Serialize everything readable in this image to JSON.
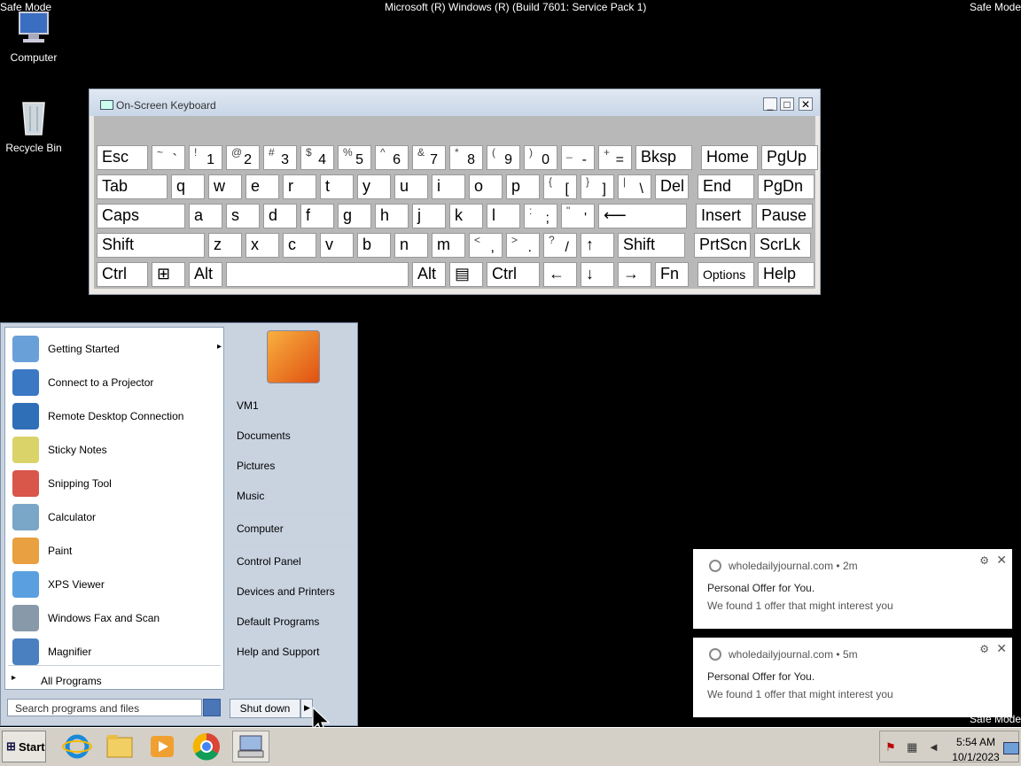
{
  "banner": {
    "left": "Safe Mode",
    "center": "Microsoft (R) Windows (R) (Build 7601: Service Pack 1)",
    "right": "Safe Mode",
    "bottom_right": "Safe Mode"
  },
  "desktop": {
    "computer": "Computer",
    "recycle": "Recycle Bin"
  },
  "osk": {
    "title": "On-Screen Keyboard",
    "rows": [
      [
        {
          "main": "Esc"
        },
        {
          "top": "~",
          "bot": "`"
        },
        {
          "top": "!",
          "bot": "1"
        },
        {
          "top": "@",
          "bot": "2"
        },
        {
          "top": "#",
          "bot": "3"
        },
        {
          "top": "$",
          "bot": "4"
        },
        {
          "top": "%",
          "bot": "5"
        },
        {
          "top": "^",
          "bot": "6"
        },
        {
          "top": "&",
          "bot": "7"
        },
        {
          "top": "*",
          "bot": "8"
        },
        {
          "top": "(",
          "bot": "9"
        },
        {
          "top": ")",
          "bot": "0"
        },
        {
          "top": "_",
          "bot": "-"
        },
        {
          "top": "+",
          "bot": "="
        },
        {
          "main": "Bksp"
        },
        {
          "main": "Home"
        },
        {
          "main": "PgUp"
        }
      ],
      [
        {
          "main": "Tab"
        },
        {
          "main": "q"
        },
        {
          "main": "w"
        },
        {
          "main": "e"
        },
        {
          "main": "r"
        },
        {
          "main": "t"
        },
        {
          "main": "y"
        },
        {
          "main": "u"
        },
        {
          "main": "i"
        },
        {
          "main": "o"
        },
        {
          "main": "p"
        },
        {
          "top": "{",
          "bot": "["
        },
        {
          "top": "}",
          "bot": "]"
        },
        {
          "top": "|",
          "bot": "\\"
        },
        {
          "main": "Del"
        },
        {
          "main": "End"
        },
        {
          "main": "PgDn"
        }
      ],
      [
        {
          "main": "Caps"
        },
        {
          "main": "a"
        },
        {
          "main": "s"
        },
        {
          "main": "d"
        },
        {
          "main": "f"
        },
        {
          "main": "g"
        },
        {
          "main": "h"
        },
        {
          "main": "j"
        },
        {
          "main": "k"
        },
        {
          "main": "l"
        },
        {
          "top": ":",
          "bot": ";"
        },
        {
          "top": "\"",
          "bot": "'"
        },
        {
          "main": "⟵"
        },
        {
          "main": "Insert"
        },
        {
          "main": "Pause"
        }
      ],
      [
        {
          "main": "Shift"
        },
        {
          "main": "z"
        },
        {
          "main": "x"
        },
        {
          "main": "c"
        },
        {
          "main": "v"
        },
        {
          "main": "b"
        },
        {
          "main": "n"
        },
        {
          "main": "m"
        },
        {
          "top": "<",
          "bot": ","
        },
        {
          "top": ">",
          "bot": "."
        },
        {
          "top": "?",
          "bot": "/"
        },
        {
          "main": "↑"
        },
        {
          "main": "Shift"
        },
        {
          "main": "PrtScn"
        },
        {
          "main": "ScrLk"
        }
      ],
      [
        {
          "main": "Ctrl"
        },
        {
          "main": "⊞"
        },
        {
          "main": "Alt"
        },
        {
          "main": ""
        },
        {
          "main": "Alt"
        },
        {
          "main": "▤"
        },
        {
          "main": "Ctrl"
        },
        {
          "main": "←"
        },
        {
          "main": "↓"
        },
        {
          "main": "→"
        },
        {
          "main": "Fn"
        },
        {
          "main": "Options"
        },
        {
          "main": "Help"
        }
      ]
    ]
  },
  "start_menu": {
    "programs": [
      {
        "label": "Getting Started",
        "icon": "getting-started-icon",
        "arrow": true
      },
      {
        "label": "Connect to a Projector",
        "icon": "projector-icon"
      },
      {
        "label": "Remote Desktop Connection",
        "icon": "remote-desktop-icon"
      },
      {
        "label": "Sticky Notes",
        "icon": "sticky-notes-icon"
      },
      {
        "label": "Snipping Tool",
        "icon": "snipping-tool-icon"
      },
      {
        "label": "Calculator",
        "icon": "calculator-icon"
      },
      {
        "label": "Paint",
        "icon": "paint-icon"
      },
      {
        "label": "XPS Viewer",
        "icon": "xps-viewer-icon"
      },
      {
        "label": "Windows Fax and Scan",
        "icon": "fax-scan-icon"
      },
      {
        "label": "Magnifier",
        "icon": "magnifier-icon"
      }
    ],
    "all_programs": "All Programs",
    "search_placeholder": "Search programs and files",
    "right_links": [
      "VM1",
      "Documents",
      "Pictures",
      "Music",
      "Computer",
      "Control Panel",
      "Devices and Printers",
      "Default Programs",
      "Help and Support"
    ],
    "shutdown": "Shut down"
  },
  "notifications": [
    {
      "source": "wholedailyjournal.com",
      "time": "2m",
      "title": "Personal Offer for You.",
      "message": "We found 1 offer that might interest you"
    },
    {
      "source": "wholedailyjournal.com",
      "time": "5m",
      "title": "Personal Offer for You.",
      "message": "We found 1 offer that might interest you"
    }
  ],
  "taskbar": {
    "start": "Start",
    "time": "5:54 AM",
    "date": "10/1/2023"
  }
}
